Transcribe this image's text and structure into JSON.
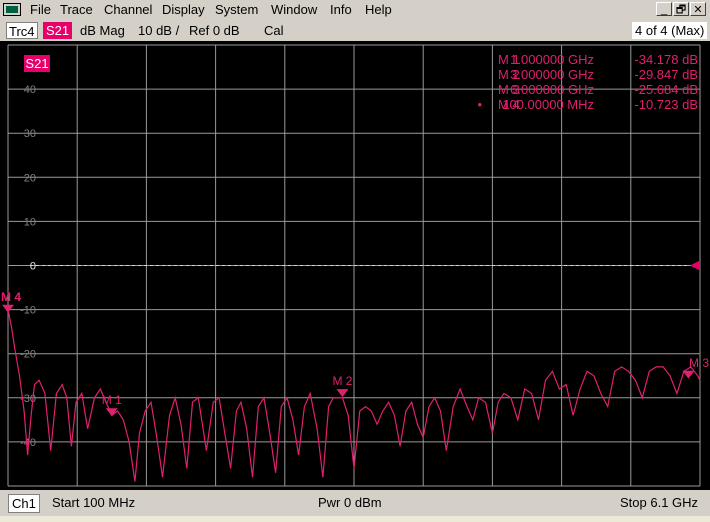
{
  "menu": [
    "File",
    "Trace",
    "Channel",
    "Display",
    "System",
    "Window",
    "Info",
    "Help"
  ],
  "window_buttons": [
    "_",
    "🗗",
    "✕"
  ],
  "trace_bar": {
    "trace": "Trc4",
    "param": "S21",
    "format": "dB Mag",
    "scale": "10 dB /",
    "ref": "Ref 0 dB",
    "cal": "Cal",
    "window": "4 of 4 (Max)"
  },
  "plot": {
    "param_label": "S21",
    "reference_value": 0,
    "colors": {
      "trace": "#e0206e",
      "grid": "#9a9a9a",
      "axis_text": "#808080",
      "ref_line": "#d8d8d8"
    },
    "y_ticks": [
      40,
      30,
      20,
      10,
      0,
      -10,
      -20,
      -30,
      -40
    ],
    "marker_table": [
      {
        "active": "",
        "name": "M 1",
        "stim": "1.000000 GHz",
        "value": "-34.178 dB"
      },
      {
        "active": "",
        "name": "M 2",
        "stim": "3.000000 GHz",
        "value": "-29.847 dB"
      },
      {
        "active": "",
        "name": "M 3",
        "stim": "6.000000 GHz",
        "value": "-25.684 dB"
      },
      {
        "active": "•",
        "name": "M 4",
        "stim": "100.00000 MHz",
        "value": "-10.723 dB"
      }
    ],
    "plot_markers": [
      {
        "label": "M 1",
        "freq_ghz": 1.0,
        "db": -34.178
      },
      {
        "label": "M 2",
        "freq_ghz": 3.0,
        "db": -29.847
      },
      {
        "label": "M 3",
        "freq_ghz": 6.0,
        "db": -25.684
      },
      {
        "label": "M 4",
        "freq_ghz": 0.1,
        "db": -10.723
      }
    ]
  },
  "chart_data": {
    "type": "line",
    "title": "",
    "xlabel": "",
    "ylabel": "",
    "xlim": [
      0.1,
      6.1
    ],
    "ylim": [
      -50,
      50
    ],
    "x_unit": "GHz",
    "y_unit": "dB",
    "series": [
      {
        "x": [
          0.1,
          0.13,
          0.16,
          0.2,
          0.24,
          0.27,
          0.3,
          0.33,
          0.37,
          0.42,
          0.47,
          0.52,
          0.57,
          0.61,
          0.65,
          0.69,
          0.74,
          0.79,
          0.85,
          0.9,
          0.95,
          1.0,
          1.05,
          1.1,
          1.15,
          1.2,
          1.24,
          1.29,
          1.34,
          1.39,
          1.44,
          1.5,
          1.55,
          1.6,
          1.65,
          1.7,
          1.75,
          1.82,
          1.88,
          1.93,
          1.98,
          2.03,
          2.08,
          2.12,
          2.17,
          2.22,
          2.27,
          2.32,
          2.37,
          2.42,
          2.47,
          2.52,
          2.57,
          2.62,
          2.67,
          2.72,
          2.78,
          2.83,
          2.88,
          2.92,
          2.96,
          3.0,
          3.05,
          3.1,
          3.15,
          3.2,
          3.25,
          3.3,
          3.35,
          3.4,
          3.45,
          3.5,
          3.55,
          3.6,
          3.65,
          3.7,
          3.75,
          3.8,
          3.85,
          3.9,
          3.96,
          4.02,
          4.08,
          4.13,
          4.18,
          4.24,
          4.3,
          4.35,
          4.4,
          4.46,
          4.52,
          4.58,
          4.64,
          4.7,
          4.76,
          4.82,
          4.88,
          4.94,
          5.0,
          5.06,
          5.12,
          5.18,
          5.24,
          5.3,
          5.36,
          5.42,
          5.48,
          5.54,
          5.6,
          5.66,
          5.72,
          5.78,
          5.84,
          5.9,
          5.96,
          6.02,
          6.08,
          6.1
        ],
        "values": [
          -10,
          -14,
          -19,
          -25,
          -33,
          -43,
          -34,
          -27,
          -26,
          -29,
          -42,
          -29,
          -27,
          -30,
          -41,
          -31,
          -29,
          -37,
          -30,
          -28,
          -31,
          -34,
          -33,
          -35,
          -40,
          -49,
          -38,
          -33,
          -31,
          -39,
          -48,
          -34,
          -30,
          -36,
          -46,
          -31,
          -30,
          -42,
          -31,
          -30,
          -38,
          -46,
          -33,
          -31,
          -37,
          -48,
          -32,
          -30,
          -38,
          -47,
          -32,
          -30,
          -35,
          -43,
          -32,
          -29,
          -37,
          -48,
          -32,
          -30,
          -30,
          -30,
          -34,
          -46,
          -33,
          -32,
          -33,
          -36,
          -33,
          -31,
          -34,
          -41,
          -33,
          -31,
          -36,
          -39,
          -32,
          -30,
          -33,
          -42,
          -32,
          -28,
          -32,
          -35,
          -30,
          -31,
          -38,
          -31,
          -29,
          -30,
          -35,
          -28,
          -29,
          -35,
          -26,
          -24,
          -28,
          -27,
          -34,
          -28,
          -24,
          -25,
          -29,
          -32,
          -24,
          -23,
          -24,
          -26,
          -30,
          -24,
          -23,
          -23,
          -25,
          -29,
          -24,
          -23,
          -25,
          -26
        ]
      }
    ]
  },
  "status_bar": {
    "channel": "Ch1",
    "start": "Start  100 MHz",
    "power": "Pwr  0 dBm",
    "stop": "Stop  6.1 GHz"
  }
}
